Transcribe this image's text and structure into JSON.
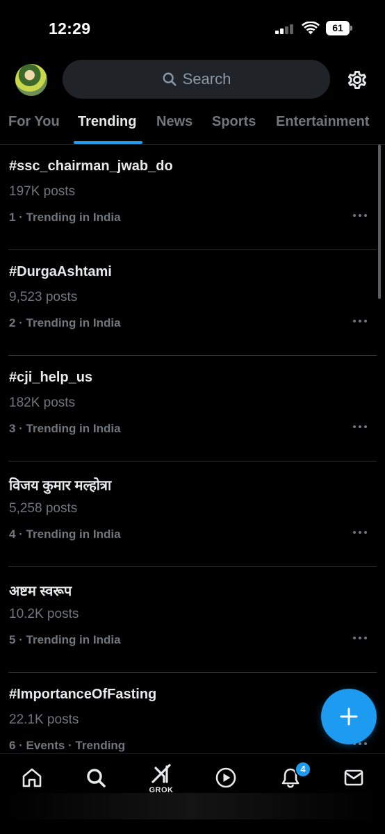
{
  "status_bar": {
    "time": "12:29",
    "battery": "61"
  },
  "search": {
    "placeholder": "Search"
  },
  "tabs": [
    {
      "label": "For You",
      "active": false
    },
    {
      "label": "Trending",
      "active": true
    },
    {
      "label": "News",
      "active": false
    },
    {
      "label": "Sports",
      "active": false
    },
    {
      "label": "Entertainment",
      "active": false
    }
  ],
  "trends": [
    {
      "name": "#ssc_chairman_jwab_do",
      "posts": "197K posts",
      "context": "1 · Trending in India"
    },
    {
      "name": "#DurgaAshtami",
      "posts": "9,523 posts",
      "context": "2 · Trending in India"
    },
    {
      "name": "#cji_help_us",
      "posts": "182K posts",
      "context": "3 · Trending in India"
    },
    {
      "name": "विजय कुमार मल्होत्रा",
      "posts": "5,258 posts",
      "context": "4 · Trending in India"
    },
    {
      "name": "अष्टम स्वरूप",
      "posts": "10.2K posts",
      "context": "5 · Trending in India"
    },
    {
      "name": "#ImportanceOfFasting",
      "posts": "22.1K posts",
      "context": "6 · Events · Trending"
    }
  ],
  "bottom_nav": {
    "grok_label": "GROK",
    "notifications_badge": "4",
    "items": [
      "home-icon",
      "search-icon",
      "grok-icon",
      "video-icon",
      "bell-icon",
      "mail-icon"
    ]
  },
  "colors": {
    "accent": "#1d9bf0",
    "background": "#000000",
    "text_primary": "#e7e9ea",
    "text_secondary": "#71767b"
  }
}
